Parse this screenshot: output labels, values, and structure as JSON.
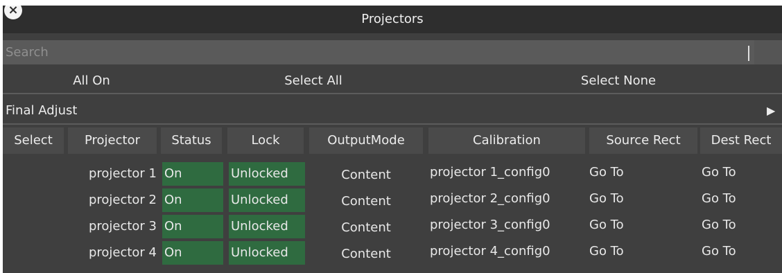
{
  "window": {
    "title": "Projectors"
  },
  "search": {
    "placeholder": "Search"
  },
  "buttons": {
    "all_on": "All On",
    "select_all": "Select All",
    "select_none": "Select None"
  },
  "section": {
    "label": "Final Adjust"
  },
  "table": {
    "columns": [
      "Select",
      "Projector",
      "Status",
      "Lock",
      "OutputMode",
      "Calibration",
      "Source Rect",
      "Dest Rect"
    ],
    "rows": [
      {
        "projector": "projector 1",
        "status": "On",
        "lock": "Unlocked",
        "output_mode": "Content",
        "calibration": "projector 1_config0",
        "source_rect": "Go To",
        "dest_rect": "Go To"
      },
      {
        "projector": "projector 2",
        "status": "On",
        "lock": "Unlocked",
        "output_mode": "Content",
        "calibration": "projector 2_config0",
        "source_rect": "Go To",
        "dest_rect": "Go To"
      },
      {
        "projector": "projector 3",
        "status": "On",
        "lock": "Unlocked",
        "output_mode": "Content",
        "calibration": "projector 3_config0",
        "source_rect": "Go To",
        "dest_rect": "Go To"
      },
      {
        "projector": "projector 4",
        "status": "On",
        "lock": "Unlocked",
        "output_mode": "Content",
        "calibration": "projector 4_config0",
        "source_rect": "Go To",
        "dest_rect": "Go To"
      }
    ]
  },
  "icons": {
    "close": "close-icon",
    "expand": "triangle-right-icon"
  },
  "colors": {
    "panel": "#3f3f3f",
    "titlebar": "#2e2e2e",
    "status_green": "#2f6b40"
  }
}
